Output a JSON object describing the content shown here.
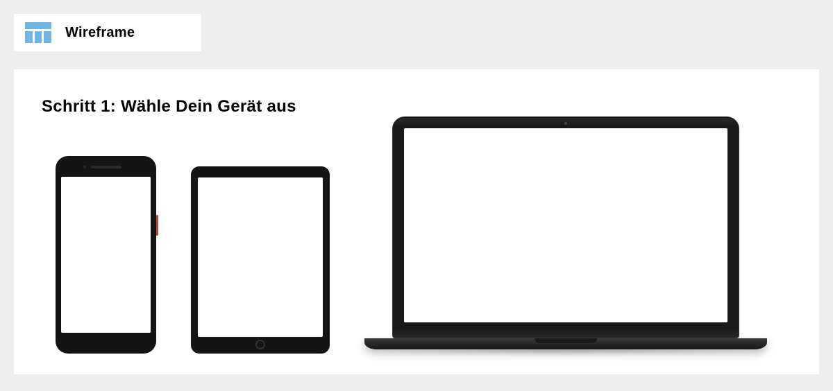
{
  "header": {
    "title": "Wireframe"
  },
  "step": {
    "heading": "Schritt 1: Wähle Dein Gerät aus"
  },
  "devices": {
    "phone_label": "phone",
    "tablet_label": "tablet",
    "laptop_label": "laptop"
  }
}
